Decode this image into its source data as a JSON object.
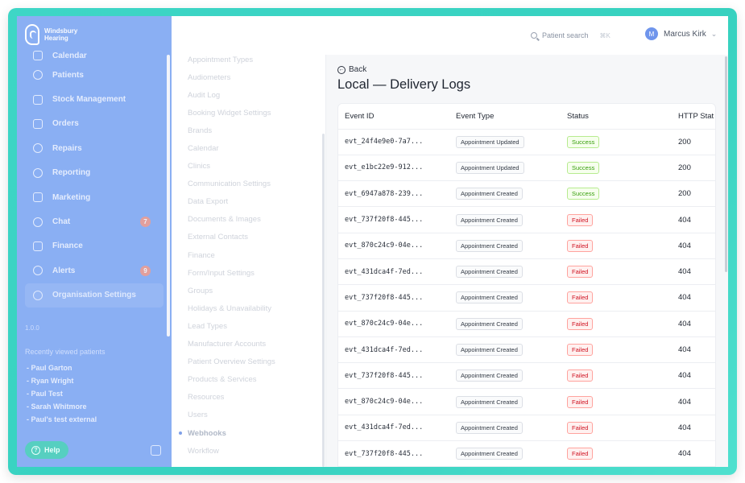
{
  "colors": {
    "frame": "#3ed6c6",
    "sidebar": "#8aaff3",
    "success": "#389e0d",
    "failed": "#cf1322"
  },
  "brand": {
    "line1": "Windsbury",
    "line2": "Hearing",
    "icon": "ear-logo-icon"
  },
  "sidebar": {
    "items": [
      {
        "label": "Calendar",
        "icon": "calendar-icon"
      },
      {
        "label": "Patients",
        "icon": "user-circle-icon"
      },
      {
        "label": "Stock Management",
        "icon": "box-icon"
      },
      {
        "label": "Orders",
        "icon": "orders-icon"
      },
      {
        "label": "Repairs",
        "icon": "wrench-icon"
      },
      {
        "label": "Reporting",
        "icon": "pie-chart-icon"
      },
      {
        "label": "Marketing",
        "icon": "mail-icon"
      },
      {
        "label": "Chat",
        "icon": "chat-icon",
        "badge": "7"
      },
      {
        "label": "Finance",
        "icon": "credit-card-icon"
      },
      {
        "label": "Alerts",
        "icon": "bell-icon",
        "badge": "9"
      },
      {
        "label": "Organisation Settings",
        "icon": "gear-icon"
      }
    ],
    "version": "1.0.0",
    "recent_title": "Recently viewed patients",
    "recent": [
      "- Paul Garton",
      "- Ryan Wright",
      "- Paul Test",
      "- Sarah Whitmore",
      "- Paul's test external"
    ],
    "help_label": "Help"
  },
  "topbar": {
    "search_placeholder": "Patient search",
    "search_shortcut": "⌘K",
    "user_initial": "M",
    "user_name": "Marcus Kirk"
  },
  "settings_nav": {
    "items": [
      "Appointment Types",
      "Audiometers",
      "Audit Log",
      "Booking Widget Settings",
      "Brands",
      "Calendar",
      "Clinics",
      "Communication Settings",
      "Data Export",
      "Documents & Images",
      "External Contacts",
      "Finance",
      "Form/Input Settings",
      "Groups",
      "Holidays & Unavailability",
      "Lead Types",
      "Manufacturer Accounts",
      "Patient Overview Settings",
      "Products & Services",
      "Resources",
      "Users",
      "Webhooks",
      "Workflow"
    ],
    "active": "Webhooks"
  },
  "main": {
    "back_label": "Back",
    "title": "Local — Delivery Logs",
    "columns": [
      "Event ID",
      "Event Type",
      "Status",
      "HTTP Stat"
    ],
    "rows": [
      {
        "id": "evt_24f4e9e0-7a7...",
        "type": "Appointment Updated",
        "status": "Success",
        "http": "200"
      },
      {
        "id": "evt_e1bc22e9-912...",
        "type": "Appointment Updated",
        "status": "Success",
        "http": "200"
      },
      {
        "id": "evt_6947a878-239...",
        "type": "Appointment Created",
        "status": "Success",
        "http": "200"
      },
      {
        "id": "evt_737f20f8-445...",
        "type": "Appointment Created",
        "status": "Failed",
        "http": "404"
      },
      {
        "id": "evt_870c24c9-04e...",
        "type": "Appointment Created",
        "status": "Failed",
        "http": "404"
      },
      {
        "id": "evt_431dca4f-7ed...",
        "type": "Appointment Created",
        "status": "Failed",
        "http": "404"
      },
      {
        "id": "evt_737f20f8-445...",
        "type": "Appointment Created",
        "status": "Failed",
        "http": "404"
      },
      {
        "id": "evt_870c24c9-04e...",
        "type": "Appointment Created",
        "status": "Failed",
        "http": "404"
      },
      {
        "id": "evt_431dca4f-7ed...",
        "type": "Appointment Created",
        "status": "Failed",
        "http": "404"
      },
      {
        "id": "evt_737f20f8-445...",
        "type": "Appointment Created",
        "status": "Failed",
        "http": "404"
      },
      {
        "id": "evt_870c24c9-04e...",
        "type": "Appointment Created",
        "status": "Failed",
        "http": "404"
      },
      {
        "id": "evt_431dca4f-7ed...",
        "type": "Appointment Created",
        "status": "Failed",
        "http": "404"
      },
      {
        "id": "evt_737f20f8-445...",
        "type": "Appointment Created",
        "status": "Failed",
        "http": "404"
      }
    ]
  }
}
